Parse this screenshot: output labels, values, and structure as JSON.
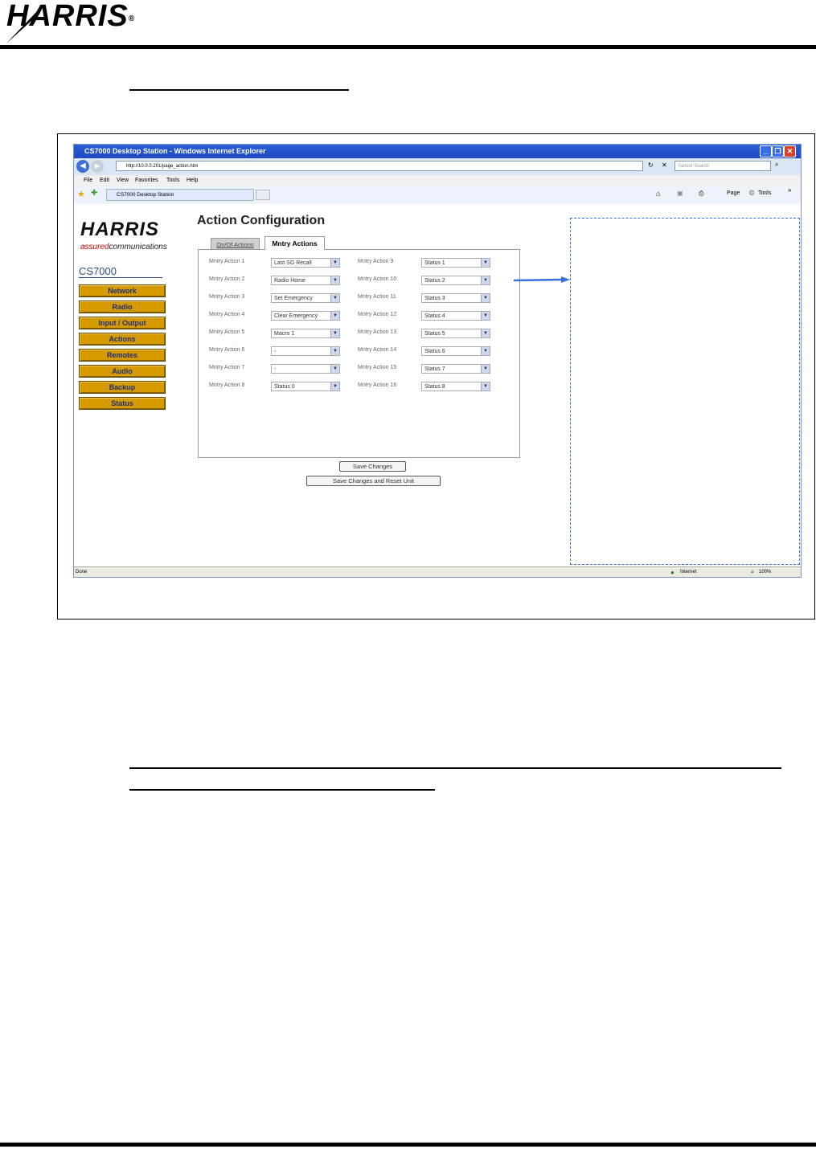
{
  "header": {
    "logo_text": "HARRIS"
  },
  "browser": {
    "window_title": "CS7000 Desktop Station - Windows Internet Explorer",
    "url": "http://10.0.0.201/page_action.htm",
    "search_placeholder": "Yahoo! Search",
    "menu": [
      "File",
      "Edit",
      "View",
      "Favorites",
      "Tools",
      "Help"
    ],
    "tab_title": "CS7000 Desktop Station",
    "toolbar": {
      "page": "Page",
      "tools": "Tools"
    },
    "status": {
      "left": "Done",
      "zone": "Internet",
      "zoom": "100%"
    }
  },
  "app": {
    "logo_text": "HARRIS",
    "tagline_red": "assured",
    "tagline_rest": "communications",
    "product": "CS7000",
    "nav": [
      "Network",
      "Radio",
      "Input / Output",
      "Actions",
      "Remotes",
      "Audio",
      "Backup",
      "Status"
    ],
    "page_title": "Action Configuration",
    "tabs": [
      "On/Of Actions",
      "Mntry Actions"
    ],
    "left_rows": [
      {
        "label": "Mntry Action 1",
        "value": "Last SG Recall"
      },
      {
        "label": "Mntry Action 2",
        "value": "Radio Home"
      },
      {
        "label": "Mntry Action 3",
        "value": "Set Emergency"
      },
      {
        "label": "Mntry Action 4",
        "value": "Clear Emergency"
      },
      {
        "label": "Mntry Action 5",
        "value": "Macro 1"
      },
      {
        "label": "Mntry Action 6",
        "value": "-"
      },
      {
        "label": "Mntry Action 7",
        "value": "-"
      },
      {
        "label": "Mntry Action 8",
        "value": "Status 0"
      }
    ],
    "right_rows": [
      {
        "label": "Mntry Action 9",
        "value": "Status 1"
      },
      {
        "label": "Mntry Action 10",
        "value": "Status 2"
      },
      {
        "label": "Mntry Action 11",
        "value": "Status 3"
      },
      {
        "label": "Mntry Action 12",
        "value": "Status 4"
      },
      {
        "label": "Mntry Action 13",
        "value": "Status 5"
      },
      {
        "label": "Mntry Action 14",
        "value": "Status 6"
      },
      {
        "label": "Mntry Action 15",
        "value": "Status 7"
      },
      {
        "label": "Mntry Action 16",
        "value": "Status 8"
      }
    ],
    "save_label": "Save Changes",
    "save_reset_label": "Save Changes and Reset Unit"
  },
  "colors": {
    "nav_button": "#d49a00",
    "nav_text": "#1f2e7a",
    "callout": "#3a6fe0",
    "title_bar": "#2c5fd7"
  }
}
